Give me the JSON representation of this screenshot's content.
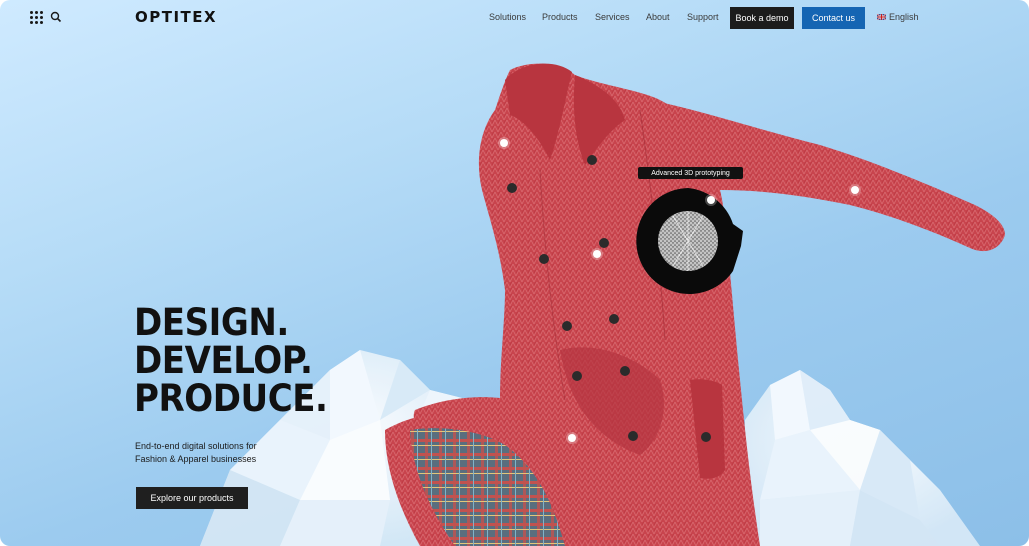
{
  "header": {
    "logo": "OPTITEX",
    "nav": [
      "Solutions",
      "Products",
      "Services",
      "About",
      "Support"
    ],
    "book_demo": "Book a demo",
    "contact": "Contact us",
    "language": "English"
  },
  "hero": {
    "headline": [
      "DESIGN.",
      "DEVELOP.",
      "PRODUCE."
    ],
    "subtext_line1": "End-to-end digital solutions for",
    "subtext_line2": "Fashion & Apparel businesses",
    "cta": "Explore our products"
  },
  "feature": {
    "tooltip": "Advanced 3D prototyping"
  },
  "colors": {
    "coat": "#c8444d",
    "brand_blue": "#1565b3",
    "dark_button": "#1c1c1c",
    "background": "#a9d3f2"
  },
  "icons": [
    "apps-grid-icon",
    "search-icon",
    "uk-flag-icon"
  ]
}
